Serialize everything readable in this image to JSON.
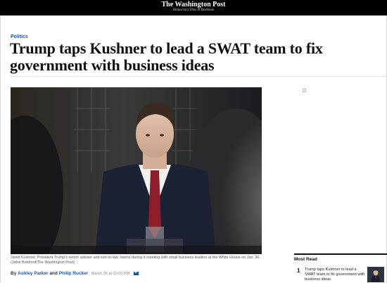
{
  "masthead": {
    "title": "The Washington Post",
    "tagline": "Democracy Dies in Darkness"
  },
  "article": {
    "section": "Politics",
    "headline": "Trump taps Kushner to lead a SWAT team to fix government with business ideas",
    "caption": "Jared Kushner, President Trump's senior adviser and son-in-law, listens during a meeting with small business leaders at the White House on Jan. 30. (Jabin Botsford/The Washington Post)",
    "byline": {
      "prefix": "By",
      "author1": "Ashley Parker",
      "conjunction": "and",
      "author2": "Philip Rucker",
      "date": "March 26 at 10:00 PM"
    }
  },
  "sidebar": {
    "most_read_title": "Most Read",
    "items": [
      {
        "rank": "1",
        "title": "Trump taps Kushner to lead a SWAT team to fix government with business ideas"
      }
    ]
  },
  "icons": {
    "email": "mail-icon",
    "ad": "ad-choice-icon"
  },
  "colors": {
    "accent": "#1955a5",
    "masthead_bg": "#000000"
  }
}
